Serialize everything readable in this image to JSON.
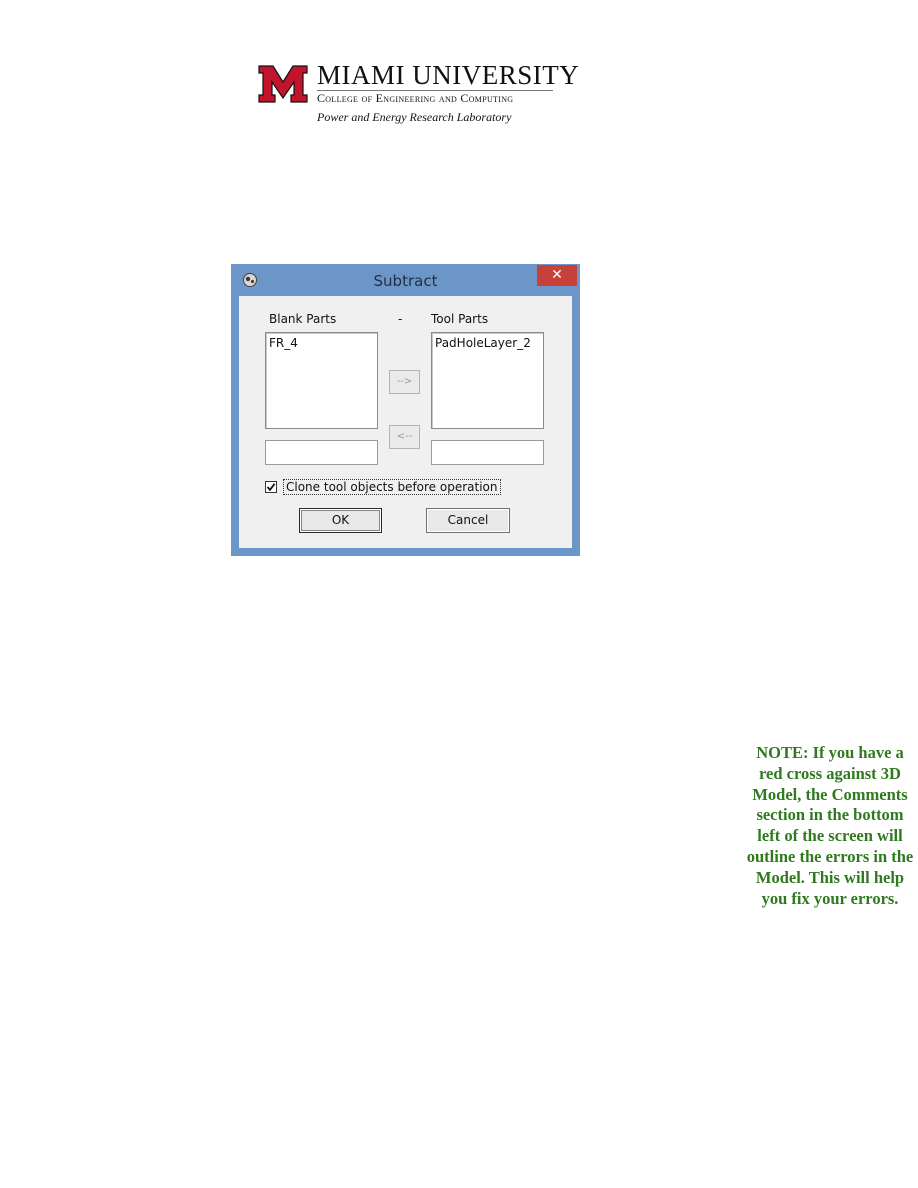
{
  "header": {
    "university": "MIAMI UNIVERSITY",
    "college": "College of Engineering and Computing",
    "lab": "Power and Energy Research Laboratory",
    "brand_color": "#c3142d"
  },
  "dialog": {
    "title": "Subtract",
    "close_icon": "close-icon",
    "blank_parts_label": "Blank Parts",
    "minus_label": "-",
    "tool_parts_label": "Tool Parts",
    "blank_parts_items": [
      "FR_4"
    ],
    "tool_parts_items": [
      "PadHoleLayer_2"
    ],
    "move_right_label": "-->",
    "move_left_label": "<--",
    "blank_input_value": "",
    "tool_input_value": "",
    "clone_checkbox_label": "Clone tool objects before operation",
    "clone_checked": true,
    "ok_label": "OK",
    "cancel_label": "Cancel",
    "frame_color": "#6c95c8",
    "close_color": "#c7403a"
  },
  "note": {
    "text": "NOTE: If you have a red cross against 3D Model, the Comments section in the bottom left of the screen will outline the errors in the Model. This will help you fix your errors.",
    "color": "#2f7a1e"
  }
}
